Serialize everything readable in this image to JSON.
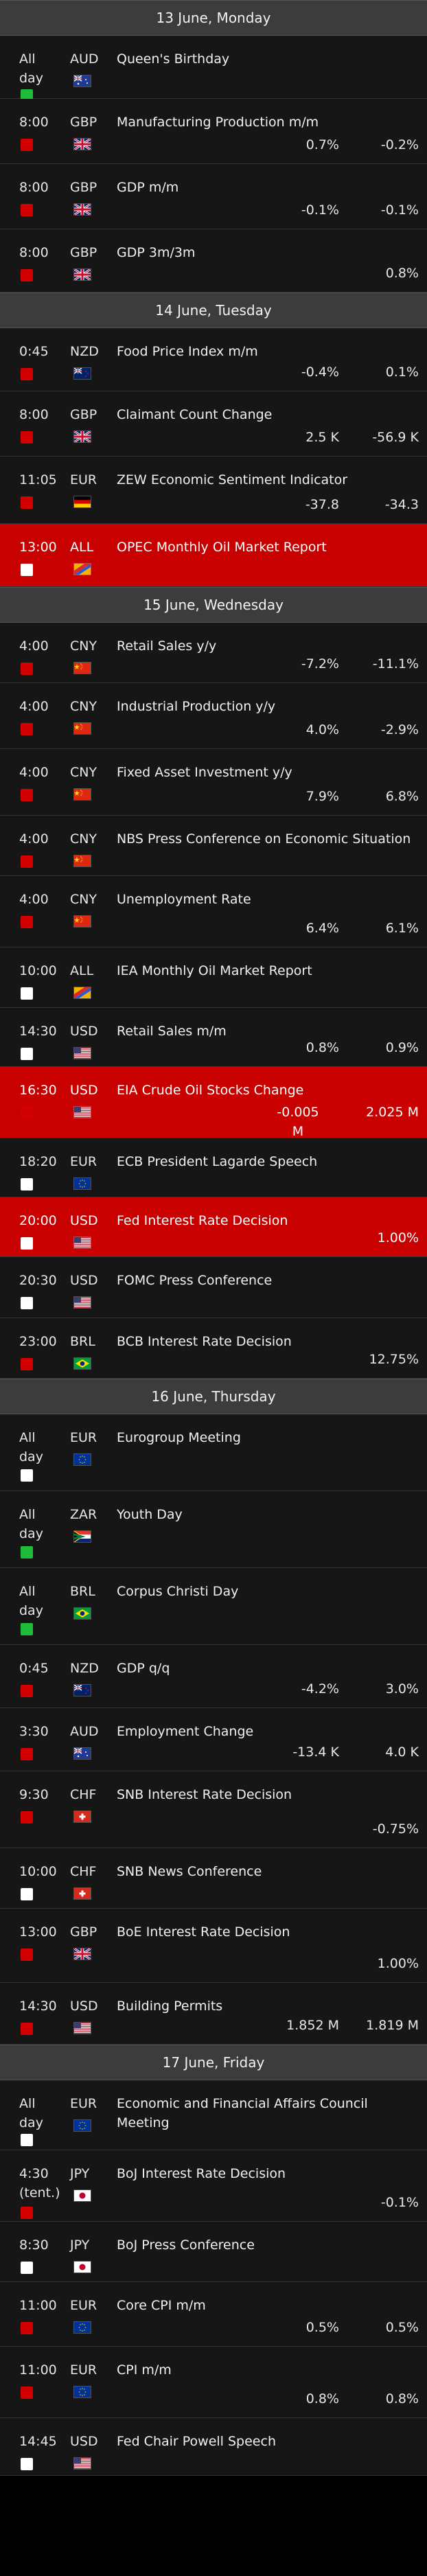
{
  "colors": {
    "background": "#000000",
    "row": "#161616",
    "row_high": "#c80000",
    "header": "#3c3c3c",
    "impact_low": "#1fbd3a",
    "impact_medium": "#d20000",
    "impact_high": "#ffffff"
  },
  "days": [
    {
      "label": "13 June, Monday",
      "events": [
        {
          "time": "All\nday",
          "currency": "AUD",
          "flag": "au-flag-icon",
          "name": "Queen's Birthday",
          "actual": "",
          "previous": "",
          "impact": "low",
          "high": false
        },
        {
          "time": "8:00",
          "currency": "GBP",
          "flag": "gb-flag-icon",
          "name": "Manufacturing Production m/m",
          "actual": "0.7%",
          "previous": "-0.2%",
          "impact": "medium",
          "high": false
        },
        {
          "time": "8:00",
          "currency": "GBP",
          "flag": "gb-flag-icon",
          "name": "GDP m/m",
          "actual": "-0.1%",
          "previous": "-0.1%",
          "impact": "medium",
          "high": false
        },
        {
          "time": "8:00",
          "currency": "GBP",
          "flag": "gb-flag-icon",
          "name": "GDP 3m/3m",
          "actual": "",
          "previous": "0.8%",
          "impact": "medium",
          "high": false
        }
      ]
    },
    {
      "label": "14 June, Tuesday",
      "events": [
        {
          "time": "0:45",
          "currency": "NZD",
          "flag": "nz-flag-icon",
          "name": "Food Price Index m/m",
          "actual": "-0.4%",
          "previous": "0.1%",
          "impact": "medium",
          "high": false
        },
        {
          "time": "8:00",
          "currency": "GBP",
          "flag": "gb-flag-icon",
          "name": "Claimant Count Change",
          "actual": "2.5 K",
          "previous": "-56.9 K",
          "impact": "medium",
          "high": false
        },
        {
          "time": "11:05",
          "currency": "EUR",
          "flag": "de-flag-icon",
          "name": "ZEW Economic Sentiment Indicator",
          "actual": "-37.8",
          "previous": "-34.3",
          "impact": "medium",
          "high": false
        },
        {
          "time": "13:00",
          "currency": "ALL",
          "flag": "all-flag-icon",
          "name": "OPEC Monthly Oil Market Report",
          "actual": "",
          "previous": "",
          "impact": "high",
          "high": true
        }
      ]
    },
    {
      "label": "15 June, Wednesday",
      "events": [
        {
          "time": "4:00",
          "currency": "CNY",
          "flag": "cn-flag-icon",
          "name": "Retail Sales y/y",
          "actual": "-7.2%",
          "previous": "-11.1%",
          "impact": "medium",
          "high": false
        },
        {
          "time": "4:00",
          "currency": "CNY",
          "flag": "cn-flag-icon",
          "name": "Industrial Production y/y",
          "actual": "4.0%",
          "previous": "-2.9%",
          "impact": "medium",
          "high": false
        },
        {
          "time": "4:00",
          "currency": "CNY",
          "flag": "cn-flag-icon",
          "name": "Fixed Asset Investment y/y",
          "actual": "7.9%",
          "previous": "6.8%",
          "impact": "medium",
          "high": false
        },
        {
          "time": "4:00",
          "currency": "CNY",
          "flag": "cn-flag-icon",
          "name": "NBS Press Conference on Economic Situation",
          "actual": "",
          "previous": "",
          "impact": "medium",
          "high": false
        },
        {
          "time": "4:00",
          "currency": "CNY",
          "flag": "cn-flag-icon",
          "name": "Unemployment Rate",
          "actual": "6.4%",
          "previous": "6.1%",
          "impact": "medium",
          "high": false
        },
        {
          "time": "10:00",
          "currency": "ALL",
          "flag": "all-flag-icon",
          "name": "IEA Monthly Oil Market Report",
          "actual": "",
          "previous": "",
          "impact": "high",
          "high": false
        },
        {
          "time": "14:30",
          "currency": "USD",
          "flag": "us-flag-icon",
          "name": "Retail Sales m/m",
          "actual": "0.8%",
          "previous": "0.9%",
          "impact": "high",
          "high": false
        },
        {
          "time": "16:30",
          "currency": "USD",
          "flag": "us-flag-icon",
          "name": "EIA Crude Oil Stocks Change",
          "actual": "-0.005\nM",
          "previous": "2.025 M",
          "impact": "medium",
          "high": true
        },
        {
          "time": "18:20",
          "currency": "EUR",
          "flag": "eu-flag-icon",
          "name": "ECB President Lagarde Speech",
          "actual": "",
          "previous": "",
          "impact": "high",
          "high": false
        },
        {
          "time": "20:00",
          "currency": "USD",
          "flag": "us-flag-icon",
          "name": "Fed Interest Rate Decision",
          "actual": "",
          "previous": "1.00%",
          "impact": "high",
          "high": true
        },
        {
          "time": "20:30",
          "currency": "USD",
          "flag": "us-flag-icon",
          "name": "FOMC Press Conference",
          "actual": "",
          "previous": "",
          "impact": "high",
          "high": false
        },
        {
          "time": "23:00",
          "currency": "BRL",
          "flag": "br-flag-icon",
          "name": "BCB Interest Rate Decision",
          "actual": "",
          "previous": "12.75%",
          "impact": "medium",
          "high": false
        }
      ]
    },
    {
      "label": "16 June, Thursday",
      "events": [
        {
          "time": "All\nday",
          "currency": "EUR",
          "flag": "eu-flag-icon",
          "name": "Eurogroup Meeting",
          "actual": "",
          "previous": "",
          "impact": "high",
          "high": false
        },
        {
          "time": "All\nday",
          "currency": "ZAR",
          "flag": "za-flag-icon",
          "name": "Youth Day",
          "actual": "",
          "previous": "",
          "impact": "low",
          "high": false
        },
        {
          "time": "All\nday",
          "currency": "BRL",
          "flag": "br-flag-icon",
          "name": "Corpus Christi Day",
          "actual": "",
          "previous": "",
          "impact": "low",
          "high": false
        },
        {
          "time": "0:45",
          "currency": "NZD",
          "flag": "nz-flag-icon",
          "name": "GDP q/q",
          "actual": "-4.2%",
          "previous": "3.0%",
          "impact": "medium",
          "high": false
        },
        {
          "time": "3:30",
          "currency": "AUD",
          "flag": "au-flag-icon",
          "name": "Employment Change",
          "actual": "-13.4 K",
          "previous": "4.0 K",
          "impact": "medium",
          "high": false
        },
        {
          "time": "9:30",
          "currency": "CHF",
          "flag": "ch-flag-icon",
          "name": "SNB Interest Rate Decision",
          "actual": "",
          "previous": "-0.75%",
          "impact": "medium",
          "high": false
        },
        {
          "time": "10:00",
          "currency": "CHF",
          "flag": "ch-flag-icon",
          "name": "SNB News Conference",
          "actual": "",
          "previous": "",
          "impact": "high",
          "high": false
        },
        {
          "time": "13:00",
          "currency": "GBP",
          "flag": "gb-flag-icon",
          "name": "BoE Interest Rate Decision",
          "actual": "",
          "previous": "1.00%",
          "impact": "medium",
          "high": false
        },
        {
          "time": "14:30",
          "currency": "USD",
          "flag": "us-flag-icon",
          "name": "Building Permits",
          "actual": "1.852 M",
          "previous": "1.819 M",
          "impact": "medium",
          "high": false
        }
      ]
    },
    {
      "label": "17 June, Friday",
      "events": [
        {
          "time": "All\nday",
          "currency": "EUR",
          "flag": "eu-flag-icon",
          "name": "Economic and Financial Affairs Council Meeting",
          "actual": "",
          "previous": "",
          "impact": "high",
          "high": false
        },
        {
          "time": "4:30\n(tent.)",
          "currency": "JPY",
          "flag": "jp-flag-icon",
          "name": "BoJ Interest Rate Decision",
          "actual": "",
          "previous": "-0.1%",
          "impact": "medium",
          "high": false
        },
        {
          "time": "8:30",
          "currency": "JPY",
          "flag": "jp-flag-icon",
          "name": "BoJ Press Conference",
          "actual": "",
          "previous": "",
          "impact": "high",
          "high": false
        },
        {
          "time": "11:00",
          "currency": "EUR",
          "flag": "eu-flag-icon",
          "name": "Core CPI m/m",
          "actual": "0.5%",
          "previous": "0.5%",
          "impact": "medium",
          "high": false
        },
        {
          "time": "11:00",
          "currency": "EUR",
          "flag": "eu-flag-icon",
          "name": "CPI m/m",
          "actual": "0.8%",
          "previous": "0.8%",
          "impact": "medium",
          "high": false
        },
        {
          "time": "14:45",
          "currency": "USD",
          "flag": "us-flag-icon",
          "name": "Fed Chair Powell Speech",
          "actual": "",
          "previous": "",
          "impact": "high",
          "high": false
        }
      ]
    }
  ]
}
